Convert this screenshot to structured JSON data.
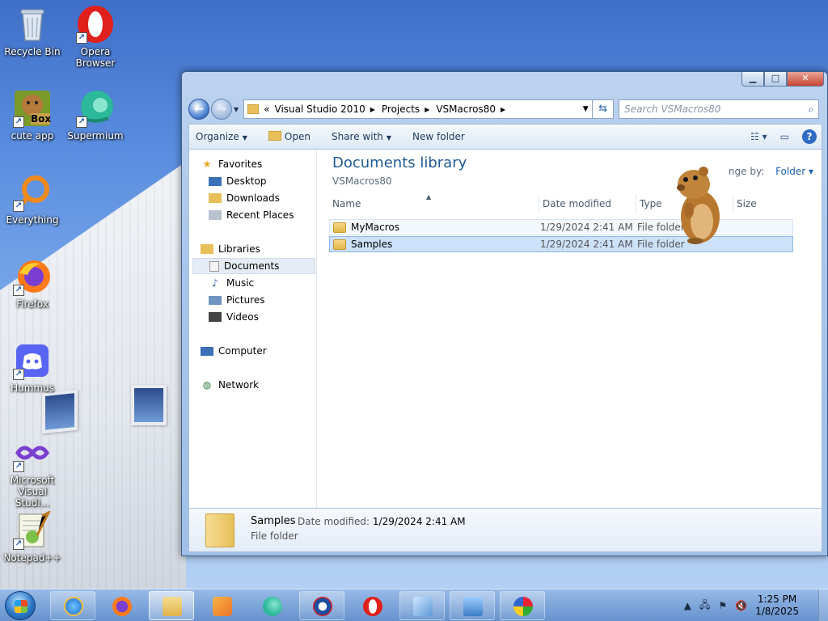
{
  "desktop": {
    "icons": [
      {
        "label": "Recycle Bin",
        "icon": "recycle-bin-icon"
      },
      {
        "label": "Opera Browser",
        "icon": "opera-icon"
      },
      {
        "label": "cute app",
        "icon": "box-app-icon",
        "badge": "Box"
      },
      {
        "label": "Supermium",
        "icon": "supermium-icon"
      },
      {
        "label": "Everything",
        "icon": "everything-icon"
      },
      {
        "label": "Firefox",
        "icon": "firefox-icon"
      },
      {
        "label": "Hummus",
        "icon": "discord-icon"
      },
      {
        "label": "Microsoft Visual Studi...",
        "icon": "visual-studio-icon"
      },
      {
        "label": "Notepad++",
        "icon": "notepadpp-icon"
      }
    ]
  },
  "window": {
    "caption": {
      "minimize": "▁",
      "maximize": "□",
      "close": "✕"
    },
    "address": {
      "chevron": "«",
      "crumbs": [
        "Visual Studio 2010",
        "Projects",
        "VSMacros80"
      ]
    },
    "search": {
      "placeholder": "Search VSMacros80"
    },
    "toolbar": {
      "organize": "Organize",
      "open": "Open",
      "share_with": "Share with",
      "new_folder": "New folder"
    },
    "nav": {
      "favorites": "Favorites",
      "desktop": "Desktop",
      "downloads": "Downloads",
      "recent_places": "Recent Places",
      "libraries": "Libraries",
      "documents": "Documents",
      "music": "Music",
      "pictures": "Pictures",
      "videos": "Videos",
      "computer": "Computer",
      "network": "Network"
    },
    "library": {
      "title": "Documents library",
      "subtitle": "VSMacros80",
      "arrange_label": "nge by:",
      "arrange_value": "Folder"
    },
    "columns": [
      "Name",
      "Date modified",
      "Type",
      "Size"
    ],
    "rows": [
      {
        "name": "MyMacros",
        "date": "1/29/2024 2:41 AM",
        "type": "File folder"
      },
      {
        "name": "Samples",
        "date": "1/29/2024 2:41 AM",
        "type": "File folder"
      }
    ],
    "details": {
      "name": "Samples",
      "date_label": "Date modified:",
      "date_value": "1/29/2024 2:41 AM",
      "type": "File folder"
    }
  },
  "taskbar": {
    "clock_time": "1:25 PM",
    "clock_date": "1/8/2025"
  }
}
